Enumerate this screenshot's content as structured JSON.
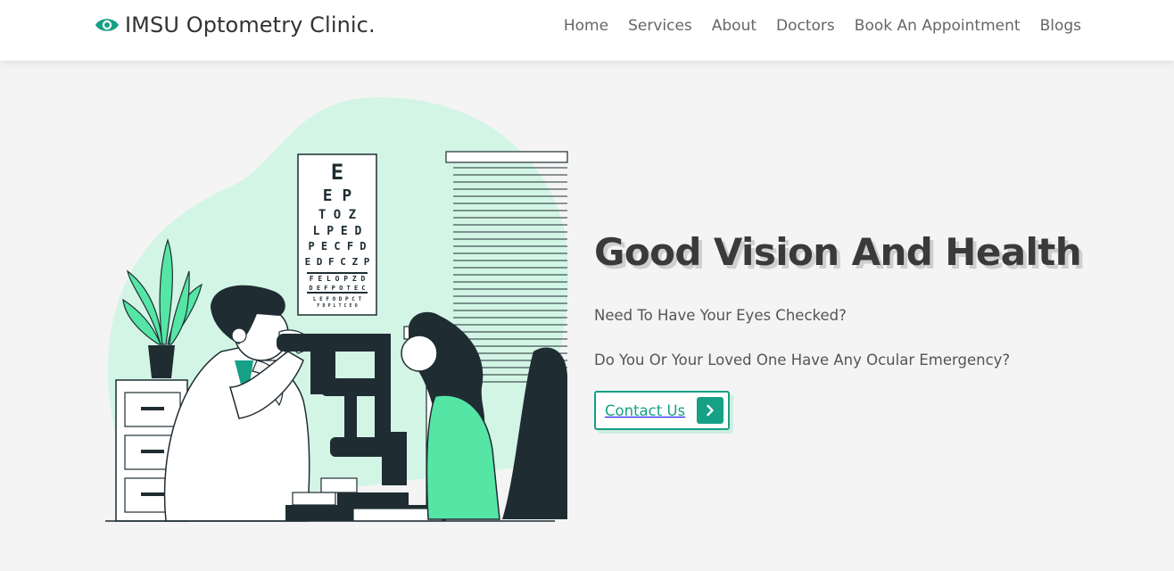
{
  "header": {
    "brand": "IMSU Optometry Clinic.",
    "brand_icon": "eye-icon",
    "nav": [
      "Home",
      "Services",
      "About",
      "Doctors",
      "Book An Appointment",
      "Blogs"
    ]
  },
  "hero": {
    "illustration": "optometrist-eye-exam-illustration",
    "title": "Good Vision And Health",
    "line1": "Need To Have Your Eyes Checked?",
    "line2": "Do You Or Your Loved One Have Any Ocular Emergency?",
    "cta_label": "Contact Us",
    "cta_icon": "chevron-right-icon",
    "eye_chart": [
      "E",
      "E P",
      "T O Z",
      "L P E D",
      "P E C F D",
      "E D F C Z P",
      "F E L O P Z D",
      "D E F P O T E C",
      "L E F O D P C T",
      "F D P L T C E O"
    ]
  },
  "colors": {
    "accent": "#16a085",
    "blob": "#d3f5e6",
    "dark": "#1f2d33",
    "shirt": "#55e6a5"
  }
}
